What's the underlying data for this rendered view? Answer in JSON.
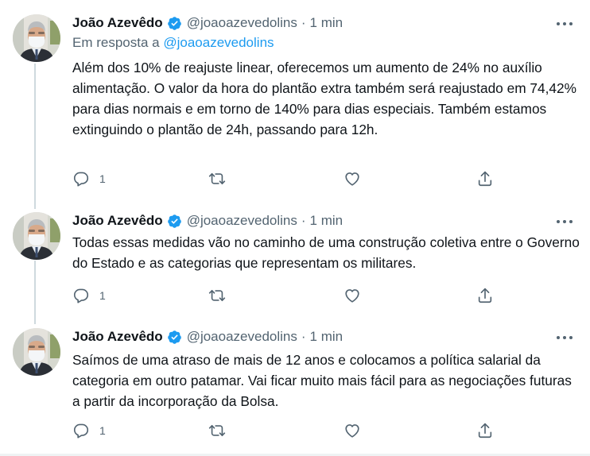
{
  "tweets": [
    {
      "author": "João Azevêdo",
      "handle": "@joaoazevedolins",
      "separator": "·",
      "time": "1 min",
      "reply_prefix": "Em resposta a",
      "reply_handle": "@joaoazevedolins",
      "text": "Além dos 10% de reajuste linear, oferecemos um aumento de 24% no auxílio alimentação. O valor da hora do plantão extra também será reajustado em 74,42% para dias normais e em torno de 140% para dias especiais. Também estamos extinguindo o plantão de 24h, passando para 12h.",
      "reply_count": "1"
    },
    {
      "author": "João Azevêdo",
      "handle": "@joaoazevedolins",
      "separator": "·",
      "time": "1 min",
      "text": "Todas essas medidas vão no caminho de uma construção coletiva entre o Governo do Estado e as categorias que representam os militares.",
      "reply_count": "1"
    },
    {
      "author": "João Azevêdo",
      "handle": "@joaoazevedolins",
      "separator": "·",
      "time": "1 min",
      "text": "Saímos de uma atraso de mais de 12 anos e colocamos a política salarial da categoria em outro patamar. Vai ficar muito mais fácil para as negociações futuras a partir da incorporação da Bolsa.",
      "reply_count": "1"
    }
  ],
  "icons": {
    "verified": "verified-badge-icon",
    "more": "more-dots-icon",
    "reply": "reply-icon",
    "retweet": "retweet-icon",
    "like": "heart-icon",
    "share": "share-icon"
  },
  "colors": {
    "accent": "#1d9bf0",
    "text": "#0f1419",
    "secondary": "#536471",
    "thread_line": "#cfd9de"
  }
}
